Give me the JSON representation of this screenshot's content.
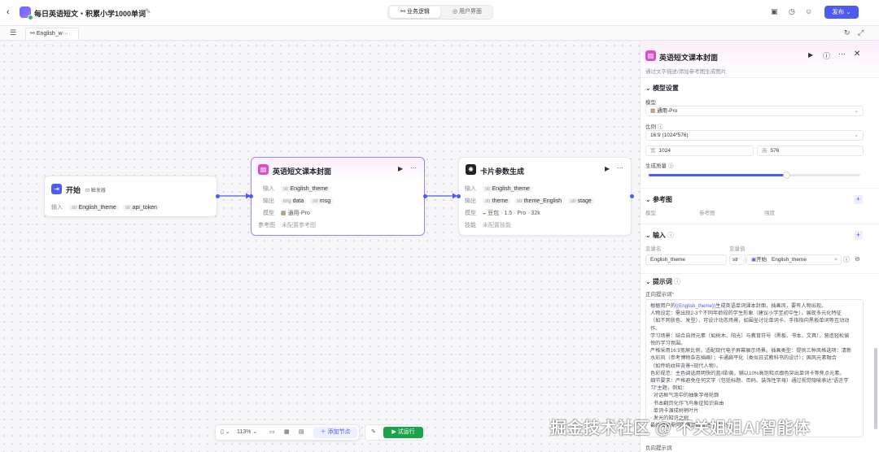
{
  "header": {
    "back_glyph": "‹",
    "app_title": "每日英语短文・积累小学1000单词",
    "tabs": [
      {
        "label": "业务逻辑",
        "active": true
      },
      {
        "label": "用户界面",
        "active": false
      }
    ],
    "publish_label": "发布",
    "accent_color": "#4e5bf2"
  },
  "canvas_tab": {
    "label": "English_w···"
  },
  "nodes": {
    "start": {
      "title": "开始",
      "badge": "触发器",
      "input_label": "输入",
      "inputs": [
        {
          "type": "str",
          "name": "English_theme"
        },
        {
          "type": "str",
          "name": "api_token"
        }
      ]
    },
    "cover": {
      "title": "英语短文课本封面",
      "rows": [
        {
          "label": "输入",
          "items": [
            {
              "type": "str",
              "name": "English_theme"
            }
          ]
        },
        {
          "label": "输出",
          "items": [
            {
              "type": "img",
              "name": "data"
            },
            {
              "type": "str",
              "name": "msg"
            }
          ]
        },
        {
          "label": "模型",
          "items": [
            {
              "type": "",
              "name": "通用-Pro"
            }
          ]
        },
        {
          "label": "参考图",
          "text": "未配置参考图"
        }
      ]
    },
    "card": {
      "title": "卡片参数生成",
      "rows": [
        {
          "label": "输入",
          "items": [
            {
              "type": "str",
              "name": "English_theme"
            }
          ]
        },
        {
          "label": "输出",
          "items": [
            {
              "type": "str",
              "name": "theme"
            },
            {
              "type": "str",
              "name": "theme_English"
            },
            {
              "type": "str",
              "name": "stage"
            }
          ]
        },
        {
          "label": "模型",
          "text": "豆包 · 1.5 · Pro · 32k"
        },
        {
          "label": "技能",
          "text": "未配置技能"
        }
      ]
    }
  },
  "toolbar": {
    "zoom": "113%",
    "add_node_label": "添加节点",
    "run_label": "试运行"
  },
  "panel": {
    "title": "英语短文课本封面",
    "description": "通过文字描述/添加参考图生成图片",
    "model_section": {
      "title": "模型设置",
      "model_label": "模型",
      "model_value": "通用-Pro",
      "ratio_label": "比例",
      "ratio_value": "16:9 (1024*576)",
      "width_prefix": "宽",
      "width_value": "1024",
      "height_prefix": "高",
      "height_value": "576",
      "quality_label": "生成质量",
      "quality_level": 0.65
    },
    "ref_section": {
      "title": "参考图",
      "columns": [
        "模型",
        "参考图",
        "强度"
      ]
    },
    "input_section": {
      "title": "输入",
      "col_name": "变量名",
      "col_value": "变量值",
      "var_name": "English_theme",
      "var_type": "str",
      "ref_node": "开始",
      "ref_var": "English_theme"
    },
    "prompt_section": {
      "title": "提示词",
      "positive_label": "正向提示词",
      "lines": [
        {
          "pre": "根据用户的",
          "var": "{{English_theme}}",
          "post": "生成英语单词课本封面，插画风，要有人物出现。"
        },
        {
          "pre": "人物设定：需出现2-3个不同年龄段的学生形象（建议小学至初中生），展现多元化特征",
          "var": "",
          "post": ""
        },
        {
          "pre": "（如不同肤色、发型），可设计动态场景，如围坐讨论单词卡、手指指向黑板单词等互动动",
          "var": "",
          "post": ""
        },
        {
          "pre": "作。",
          "var": "",
          "post": ""
        },
        {
          "pre": "学习场景：结合自然元素（如树木、阳光）与教育符号（黑板、书本、文具），营造轻松愉",
          "var": "",
          "post": ""
        },
        {
          "pre": "悦的学习氛围。",
          "var": "",
          "post": ""
        },
        {
          "pre": "严格采用16:9宽屏比例，适配现代电子屏幕展示场景。插画类型：提供三种风格选项：清新",
          "var": "",
          "post": ""
        },
        {
          "pre": "水彩风（参考博物杂志插画）；卡通扁平化（类似日式教科书的设计）；国风元素融合",
          "var": "",
          "post": ""
        },
        {
          "pre": "（如传统纹样背景+现代人物）。",
          "var": "",
          "post": ""
        },
        {
          "pre": "色彩规范：主色调选用明快的蓝/绿/黄，辅以10%高饱和点缀色突出单词卡等焦点元素。",
          "var": "",
          "post": ""
        },
        {
          "pre": "细节要求：严格避免任何文字（包括标题、页码、装饰性字母）通过视觉隐喻表达\"语言学",
          "var": "",
          "post": ""
        },
        {
          "pre": "习\"主题，例如：",
          "var": "",
          "post": ""
        },
        {
          "pre": "· 对话框气泡中的抽象字母轮廓",
          "var": "",
          "post": ""
        },
        {
          "pre": "· 书本翻页化作飞鸟象征知识自由",
          "var": "",
          "post": ""
        },
        {
          "pre": "· 单词卡演成树梢叶片",
          "var": "",
          "post": ""
        },
        {
          "pre": "· 发光的知识之树",
          "var": "",
          "post": ""
        },
        {
          "pre": "最终效果需同时满足教育性与艺术性",
          "var": "",
          "post": ""
        }
      ],
      "negative_label": "负向提示词"
    }
  },
  "watermark": "掘金技术社区 @ 不关姐姐AI智能体"
}
